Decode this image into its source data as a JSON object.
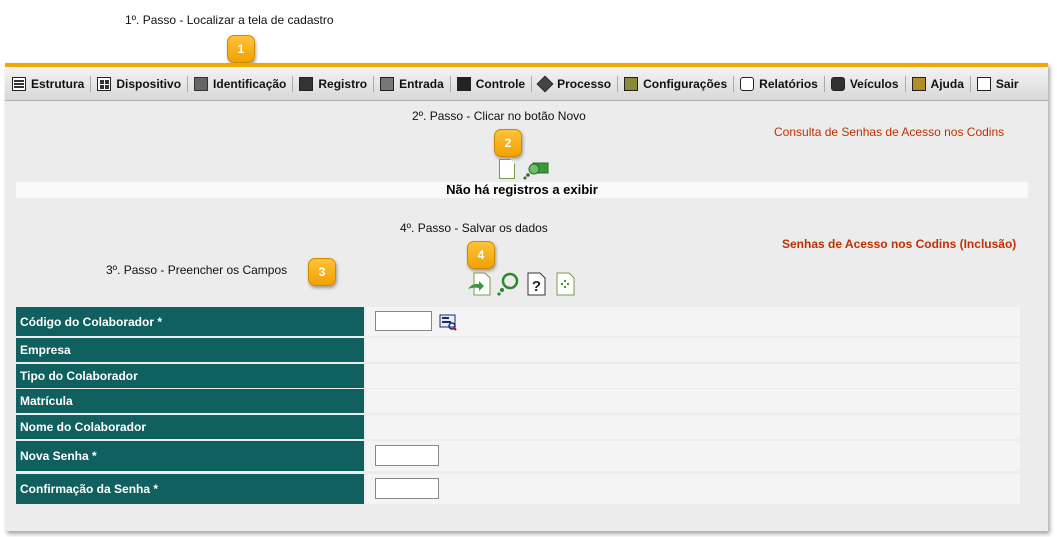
{
  "steps": {
    "step1": "1º. Passo - Localizar a tela de cadastro",
    "step2": "2º. Passo - Clicar no botão Novo",
    "step3": "3º. Passo - Preencher os Campos",
    "step4": "4º. Passo - Salvar os dados"
  },
  "callouts": {
    "c1": "1",
    "c2": "2",
    "c3": "3",
    "c4": "4"
  },
  "menu": {
    "items": [
      {
        "label": "Estrutura",
        "icon": "estrutura-icon"
      },
      {
        "label": "Dispositivo",
        "icon": "dispositivo-icon"
      },
      {
        "label": "Identificação",
        "icon": "identificacao-icon"
      },
      {
        "label": "Registro",
        "icon": "registro-icon"
      },
      {
        "label": "Entrada",
        "icon": "entrada-icon"
      },
      {
        "label": "Controle",
        "icon": "controle-icon"
      },
      {
        "label": "Processo",
        "icon": "processo-icon"
      },
      {
        "label": "Configurações",
        "icon": "configuracoes-icon"
      },
      {
        "label": "Relatórios",
        "icon": "relatorios-icon"
      },
      {
        "label": "Veículos",
        "icon": "veiculos-icon"
      },
      {
        "label": "Ajuda",
        "icon": "ajuda-icon"
      },
      {
        "label": "Sair",
        "icon": "sair-icon"
      }
    ]
  },
  "consulta": {
    "title": "Consulta de Senhas de Acesso nos Codins",
    "empty_message": "Não há registros a exibir"
  },
  "inclusao": {
    "title": "Senhas de Acesso nos Codins (Inclusão)"
  },
  "form": {
    "codigo_label": "Código do Colaborador *",
    "codigo_value": "",
    "empresa_label": "Empresa",
    "tipo_label": "Tipo do Colaborador",
    "matricula_label": "Matrícula",
    "nome_label": "Nome do Colaborador",
    "nova_senha_label": "Nova Senha *",
    "nova_senha_value": "",
    "confirmacao_label": "Confirmação da Senha *",
    "confirmacao_value": ""
  },
  "colors": {
    "accent_orange": "#f0a800",
    "label_teal": "#116060",
    "title_red": "#c03000"
  }
}
